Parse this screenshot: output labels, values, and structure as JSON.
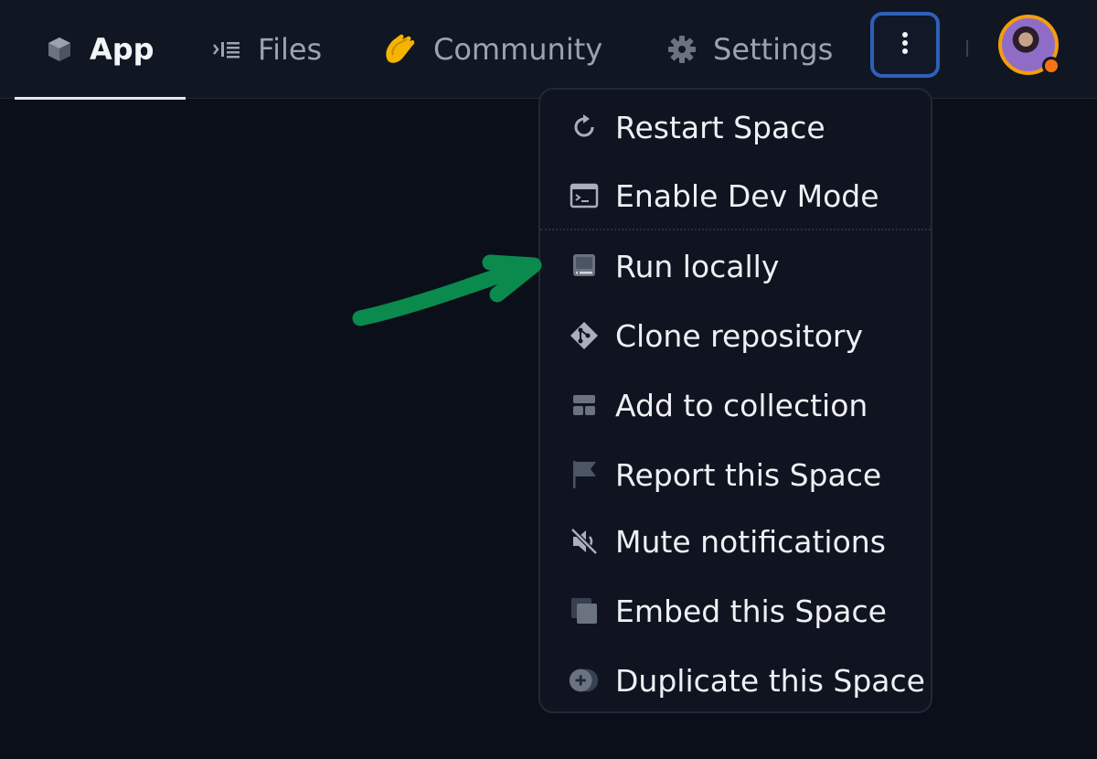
{
  "nav": {
    "tabs": [
      {
        "label": "App",
        "icon": "cube-icon",
        "active": true
      },
      {
        "label": "Files",
        "icon": "files-icon",
        "active": false
      },
      {
        "label": "Community",
        "icon": "clapping-hands-icon",
        "active": false
      },
      {
        "label": "Settings",
        "icon": "gear-icon",
        "active": false
      }
    ],
    "more_icon": "kebab-menu-icon",
    "avatar_icon": "user-avatar"
  },
  "menu": {
    "items": [
      {
        "label": "Restart Space",
        "icon": "restart-icon"
      },
      {
        "label": "Enable Dev Mode",
        "icon": "terminal-icon"
      },
      {
        "label": "Run locally",
        "icon": "computer-icon"
      },
      {
        "label": "Clone repository",
        "icon": "git-icon"
      },
      {
        "label": "Add to collection",
        "icon": "collection-icon"
      },
      {
        "label": "Report this Space",
        "icon": "flag-icon"
      },
      {
        "label": "Mute notifications",
        "icon": "mute-icon"
      },
      {
        "label": "Embed this Space",
        "icon": "embed-icon"
      },
      {
        "label": "Duplicate this Space",
        "icon": "duplicate-icon"
      }
    ]
  },
  "colors": {
    "background": "#0b0f19",
    "topbar": "#101622",
    "menu_bg": "#0f1420",
    "highlight_border": "#2f5fb8",
    "annotation_arrow": "#0a8a4c",
    "avatar_ring": "#f59e0b"
  }
}
